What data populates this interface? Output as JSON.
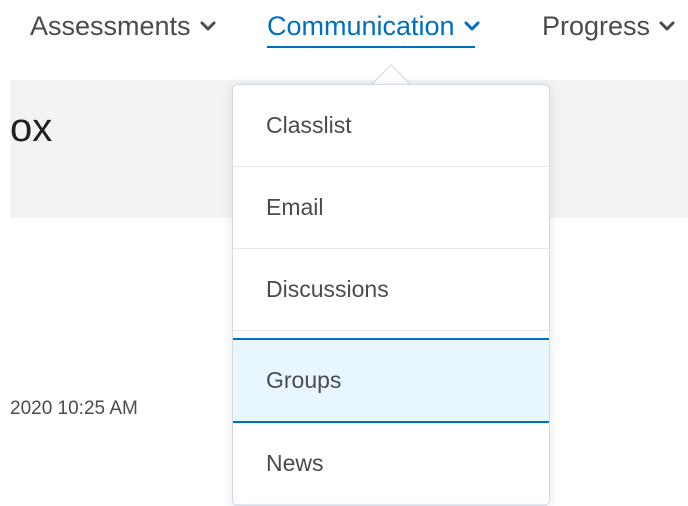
{
  "nav": {
    "items": [
      {
        "label": "Assessments",
        "icon": "chevron-down-icon",
        "active": false
      },
      {
        "label": "Communication",
        "icon": "chevron-down-icon",
        "active": true
      },
      {
        "label": "Progress",
        "icon": "chevron-down-icon",
        "active": false
      }
    ]
  },
  "page": {
    "title_fragment": "ox",
    "timestamp_fragment": "2020 10:25 AM"
  },
  "dropdown": {
    "items": [
      {
        "label": "Classlist",
        "state": "normal"
      },
      {
        "label": "Email",
        "state": "normal"
      },
      {
        "label": "Discussions",
        "state": "normal"
      },
      {
        "label": "Groups",
        "state": "hover"
      },
      {
        "label": "News",
        "state": "normal"
      }
    ]
  },
  "colors": {
    "accent": "#006fbf",
    "text": "#494c4e",
    "hover_background": "#e8f7fe",
    "header_band": "#f1f3f5"
  }
}
